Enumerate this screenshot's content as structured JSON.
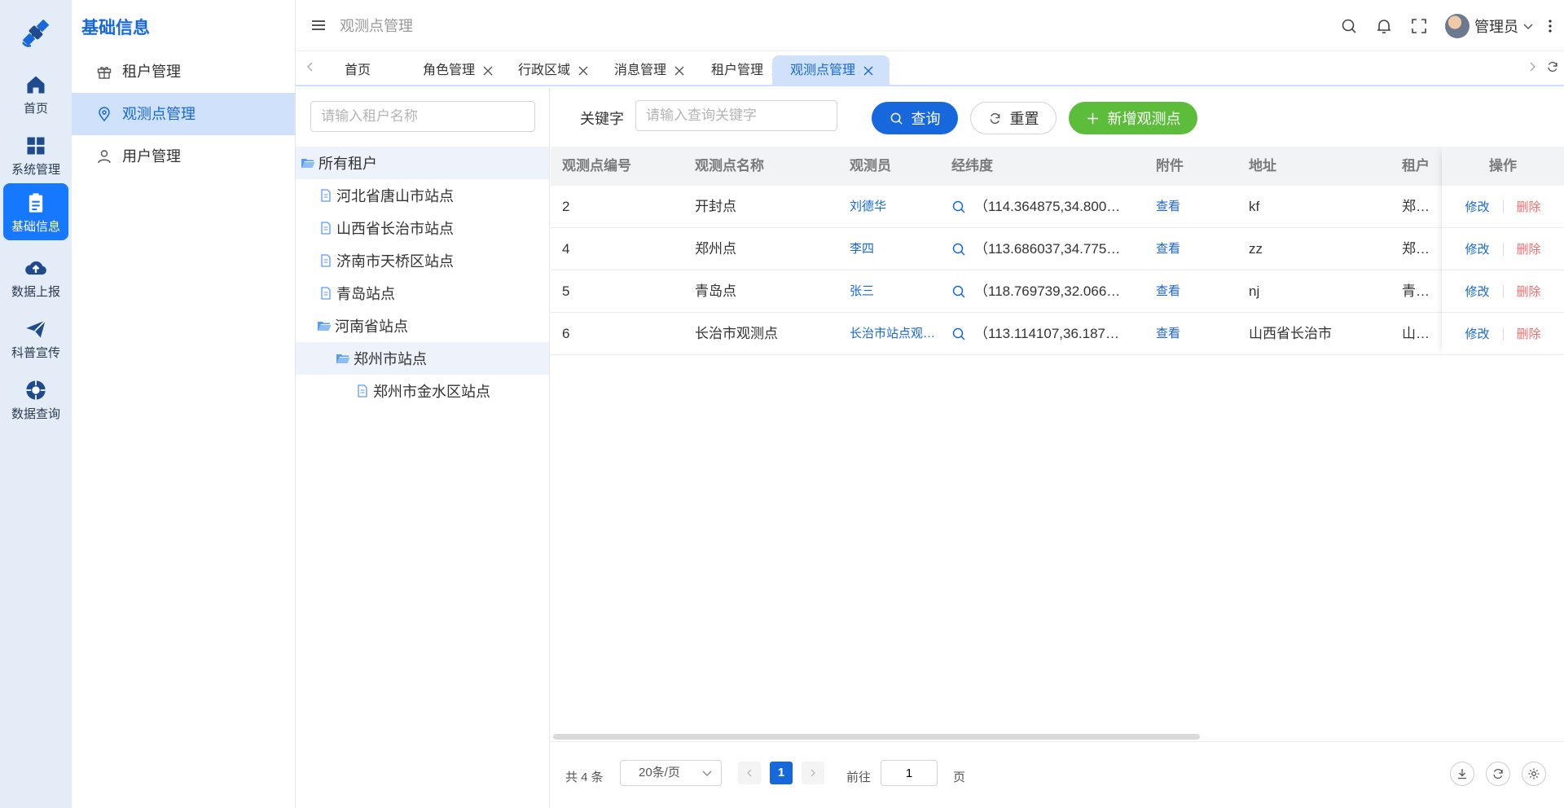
{
  "rail": {
    "items": [
      {
        "label": "首页",
        "icon": "home-icon"
      },
      {
        "label": "系统管理",
        "icon": "grid-icon"
      },
      {
        "label": "基础信息",
        "icon": "clipboard-icon",
        "active": true
      },
      {
        "label": "数据上报",
        "icon": "cloud-upload-icon"
      },
      {
        "label": "科普宣传",
        "icon": "paper-plane-icon"
      },
      {
        "label": "数据查询",
        "icon": "compass-icon"
      }
    ]
  },
  "submenu": {
    "title": "基础信息",
    "items": [
      {
        "label": "租户管理",
        "icon": "gift-icon"
      },
      {
        "label": "观测点管理",
        "icon": "location-pin-icon",
        "active": true
      },
      {
        "label": "用户管理",
        "icon": "user-icon"
      }
    ]
  },
  "header": {
    "breadcrumb": "观测点管理",
    "username": "管理员"
  },
  "tabs": [
    {
      "label": "首页",
      "closable": false
    },
    {
      "label": "角色管理",
      "closable": true
    },
    {
      "label": "行政区域",
      "closable": true
    },
    {
      "label": "消息管理",
      "closable": true
    },
    {
      "label": "租户管理",
      "closable": true
    },
    {
      "label": "观测点管理",
      "closable": true,
      "active": true
    }
  ],
  "tree": {
    "search_placeholder": "请输入租户名称",
    "nodes": [
      {
        "label": "所有租户",
        "type": "folder-open",
        "level": 0
      },
      {
        "label": "河北省唐山市站点",
        "type": "file",
        "level": 1
      },
      {
        "label": "山西省长治市站点",
        "type": "file",
        "level": 1
      },
      {
        "label": "济南市天桥区站点",
        "type": "file",
        "level": 1
      },
      {
        "label": "青岛站点",
        "type": "file",
        "level": 1
      },
      {
        "label": "河南省站点",
        "type": "folder-open",
        "level": 1
      },
      {
        "label": "郑州市站点",
        "type": "folder-open",
        "level": 2
      },
      {
        "label": "郑州市金水区站点",
        "type": "file",
        "level": 3
      }
    ]
  },
  "filter": {
    "keyword_label": "关键字",
    "keyword_placeholder": "请输入查询关键字",
    "query_label": "查询",
    "reset_label": "重置",
    "add_label": "新增观测点"
  },
  "table": {
    "columns": [
      "观测点编号",
      "观测点名称",
      "观测员",
      "经纬度",
      "附件",
      "地址",
      "租户",
      "操作"
    ],
    "rows": [
      {
        "id": "2",
        "name": "开封点",
        "observer": "刘德华",
        "coords": "（114.364875,34.800…",
        "attachment": "查看",
        "address": "kf",
        "tenant": "郑州市金水区站点"
      },
      {
        "id": "4",
        "name": "郑州点",
        "observer": "李四",
        "coords": "（113.686037,34.775…",
        "attachment": "查看",
        "address": "zz",
        "tenant": "郑州市站点"
      },
      {
        "id": "5",
        "name": "青岛点",
        "observer": "张三",
        "coords": "（118.769739,32.066…",
        "attachment": "查看",
        "address": "nj",
        "tenant": "青岛站点"
      },
      {
        "id": "6",
        "name": "长治市观测点",
        "observer": "长治市站点观测员",
        "coords": "（113.114107,36.187…",
        "attachment": "查看",
        "address": "山西省长治市",
        "tenant": "山西省长治市站点"
      }
    ],
    "edit_label": "修改",
    "delete_label": "删除"
  },
  "pagination": {
    "total": "共 4 条",
    "page_size": "20条/页",
    "current_page": "1",
    "goto_label": "前往",
    "goto_value": "1",
    "page_unit": "页"
  },
  "colors": {
    "primary": "#1668dc",
    "success": "#5cbd3b",
    "danger": "#f56c6c",
    "rail_bg": "#e4ecf7",
    "active_bg": "#cfe1fb"
  }
}
